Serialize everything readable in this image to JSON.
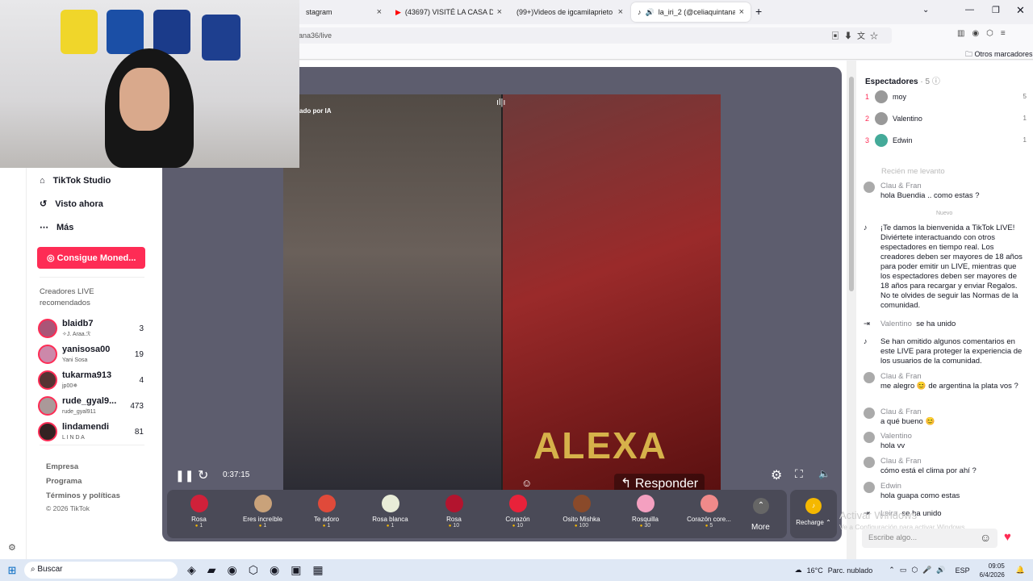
{
  "tabs": [
    {
      "label": "stagram"
    },
    {
      "label": "(43697) VISITÉ LA CASA DE SOF"
    },
    {
      "label": "(99+)Videos de igcamilaprieto ("
    },
    {
      "label": "la_iri_2 (@celiaquintana36)"
    }
  ],
  "url": "ana36/live",
  "bookmarks": {
    "other": "Otros marcadores"
  },
  "sidebar": {
    "nav": [
      {
        "label": "TikTok Studio",
        "icon": "studio-icon"
      },
      {
        "label": "Visto ahora",
        "icon": "history-icon"
      },
      {
        "label": "Más",
        "icon": "more-icon"
      }
    ],
    "coins_button": "Consigue Moned...",
    "creators_heading": "Creadores LIVE recomendados",
    "creators": [
      {
        "name": "blaidb7",
        "sub": "✧J. Araa.ℛ",
        "count": "3"
      },
      {
        "name": "yanisosa00",
        "sub": "Yani Sosa",
        "count": "19"
      },
      {
        "name": "tukarma913",
        "sub": "jp00✵",
        "count": "4"
      },
      {
        "name": "rude_gyal9...",
        "sub": "rude_gyal911",
        "count": "473"
      },
      {
        "name": "lindamendi",
        "sub": "L I N D A",
        "count": "81"
      }
    ],
    "footer": [
      "Empresa",
      "Programa",
      "Términos y políticas",
      "© 2026 TikTok"
    ]
  },
  "player": {
    "ai_label": "ado por IA",
    "time": "0:37:15",
    "overlay_name": "ALEXA",
    "reply": "Responder",
    "more": "More",
    "recharge": "Recharge"
  },
  "gifts": [
    {
      "name": "Rosa",
      "price": "1",
      "color": "#d0213a"
    },
    {
      "name": "Eres increíble",
      "price": "1",
      "color": "#c9a27a"
    },
    {
      "name": "Te adoro",
      "price": "1",
      "color": "#e04a3a"
    },
    {
      "name": "Rosa blanca",
      "price": "1",
      "color": "#e8ecd8"
    },
    {
      "name": "Rosa",
      "price": "10",
      "color": "#b3142e"
    },
    {
      "name": "Corazón",
      "price": "10",
      "color": "#e8223a"
    },
    {
      "name": "Osito Mishka",
      "price": "100",
      "color": "#8a4a2a"
    },
    {
      "name": "Rosquilla",
      "price": "30",
      "color": "#f4a0c0"
    },
    {
      "name": "Corazón core...",
      "price": "5",
      "color": "#f08a8a"
    }
  ],
  "viewers": {
    "title": "Espectadores",
    "count": "5",
    "list": [
      {
        "rank": "1",
        "name": "moy",
        "n": "5"
      },
      {
        "rank": "2",
        "name": "Valentino",
        "n": "1"
      },
      {
        "rank": "3",
        "name": "Edwin",
        "n": "1"
      }
    ]
  },
  "chat": {
    "faded": "Recién me levanto",
    "new_label": "Nuevo",
    "messages": [
      {
        "user": "Clau & Fran",
        "text": "hola Buendia .. como estas ?"
      },
      {
        "user": "",
        "text": "¡Te damos la bienvenida a TikTok LIVE! Diviértete interactuando con otros espectadores en tiempo real. Los creadores deben ser mayores de 18 años para poder emitir un LIVE, mientras que los espectadores deben ser mayores de 18 años para recargar y enviar Regalos. No te olvides de seguir las Normas de la comunidad."
      },
      {
        "user": "Valentino",
        "text": "se ha unido"
      },
      {
        "user": "",
        "text": "Se han omitido algunos comentarios en este LIVE para proteger la experiencia de los usuarios de la comunidad."
      },
      {
        "user": "Clau & Fran",
        "text": "me alegro 😊 de argentina la plata vos ?"
      },
      {
        "user": "Clau & Fran",
        "text": "a qué bueno 😊"
      },
      {
        "user": "Valentino",
        "text": "hola vv"
      },
      {
        "user": "Clau & Fran",
        "text": "cómo está el clima por ahí ?"
      },
      {
        "user": "Edwin",
        "text": "hola guapa como estas"
      },
      {
        "user": "Leira",
        "text": "se ha unido"
      }
    ],
    "input_placeholder": "Escribe algo...",
    "watermark": "Activar Windows",
    "watermark_sub": "Ve a Configuración para activar Windows."
  },
  "taskbar": {
    "search": "Buscar",
    "weather": "16°C",
    "weather_text": "Parc. nublado",
    "lang": "ESP",
    "time": "09:05",
    "date": "6/4/2026"
  }
}
